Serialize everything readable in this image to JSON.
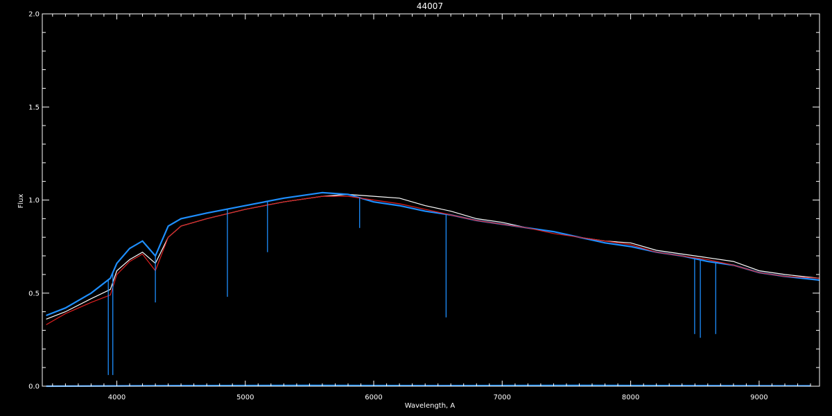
{
  "chart_data": {
    "type": "line",
    "title": "44007",
    "xlabel": "Wavelength, A",
    "ylabel": "Flux",
    "xlim": [
      3420,
      9470
    ],
    "ylim": [
      0.0,
      2.0
    ],
    "x_ticks": [
      4000,
      5000,
      6000,
      7000,
      8000,
      9000
    ],
    "x_tick_labels": [
      "4000",
      "5000",
      "6000",
      "7000",
      "8000",
      "9000"
    ],
    "y_ticks": [
      0.0,
      0.5,
      1.0,
      1.5,
      2.0
    ],
    "y_tick_labels": [
      "0.0",
      "0.5",
      "1.0",
      "1.5",
      "2.0"
    ],
    "grid": false,
    "colors": {
      "background": "#000000",
      "axes": "#ffffff",
      "white_spectrum": "#ffffff",
      "blue_spectrum": "#1e8fff",
      "red_model": "#e02020"
    },
    "series": [
      {
        "color": "white",
        "x": [
          3450,
          3600,
          3800,
          3950,
          4000,
          4100,
          4200,
          4300,
          4400,
          4500,
          4700,
          5000,
          5300,
          5600,
          5800,
          6000,
          6200,
          6400,
          6600,
          6800,
          7000,
          7200,
          7400,
          7600,
          7800,
          8000,
          8200,
          8400,
          8600,
          8800,
          9000,
          9200,
          9470
        ],
        "y": [
          0.36,
          0.4,
          0.47,
          0.52,
          0.62,
          0.68,
          0.72,
          0.66,
          0.8,
          0.86,
          0.9,
          0.95,
          0.99,
          1.02,
          1.03,
          1.02,
          1.01,
          0.97,
          0.94,
          0.9,
          0.88,
          0.85,
          0.83,
          0.8,
          0.78,
          0.77,
          0.73,
          0.71,
          0.69,
          0.67,
          0.62,
          0.6,
          0.58
        ]
      },
      {
        "color": "blue",
        "x": [
          3450,
          3600,
          3800,
          3950,
          4000,
          4100,
          4200,
          4300,
          4400,
          4500,
          4700,
          5000,
          5300,
          5600,
          5800,
          6000,
          6200,
          6400,
          6600,
          6800,
          7000,
          7200,
          7400,
          7600,
          7800,
          8000,
          8200,
          8400,
          8600,
          8800,
          9000,
          9200,
          9470
        ],
        "y": [
          0.38,
          0.42,
          0.5,
          0.58,
          0.66,
          0.74,
          0.78,
          0.7,
          0.86,
          0.9,
          0.93,
          0.97,
          1.01,
          1.04,
          1.03,
          0.99,
          0.97,
          0.94,
          0.92,
          0.89,
          0.87,
          0.85,
          0.83,
          0.8,
          0.77,
          0.75,
          0.72,
          0.7,
          0.67,
          0.65,
          0.61,
          0.59,
          0.57
        ]
      },
      {
        "color": "red",
        "x": [
          3450,
          3600,
          3800,
          3950,
          4000,
          4100,
          4200,
          4300,
          4400,
          4500,
          4700,
          5000,
          5300,
          5600,
          5800,
          6000,
          6200,
          6400,
          6600,
          6800,
          7000,
          7200,
          7400,
          7600,
          7800,
          8000,
          8200,
          8400,
          8600,
          8800,
          9000,
          9200,
          9470
        ],
        "y": [
          0.33,
          0.39,
          0.45,
          0.49,
          0.6,
          0.67,
          0.71,
          0.62,
          0.8,
          0.86,
          0.9,
          0.95,
          0.99,
          1.02,
          1.02,
          1.0,
          0.98,
          0.95,
          0.92,
          0.89,
          0.87,
          0.85,
          0.82,
          0.8,
          0.78,
          0.76,
          0.72,
          0.7,
          0.68,
          0.65,
          0.61,
          0.59,
          0.58
        ]
      },
      {
        "color": "blue",
        "x": [
          3450,
          4500,
          5500,
          6500,
          7600,
          8500,
          9400
        ],
        "y": [
          0.0,
          0.003,
          0.004,
          0.003,
          0.004,
          0.003,
          0.002
        ]
      }
    ],
    "absorption_lines": [
      {
        "x": 3934,
        "y": 0.06
      },
      {
        "x": 3969,
        "y": 0.06
      },
      {
        "x": 4300,
        "y": 0.45
      },
      {
        "x": 4861,
        "y": 0.48
      },
      {
        "x": 5173,
        "y": 0.72
      },
      {
        "x": 5890,
        "y": 0.85
      },
      {
        "x": 6563,
        "y": 0.37
      },
      {
        "x": 8498,
        "y": 0.28
      },
      {
        "x": 8542,
        "y": 0.26
      },
      {
        "x": 8662,
        "y": 0.28
      }
    ]
  }
}
